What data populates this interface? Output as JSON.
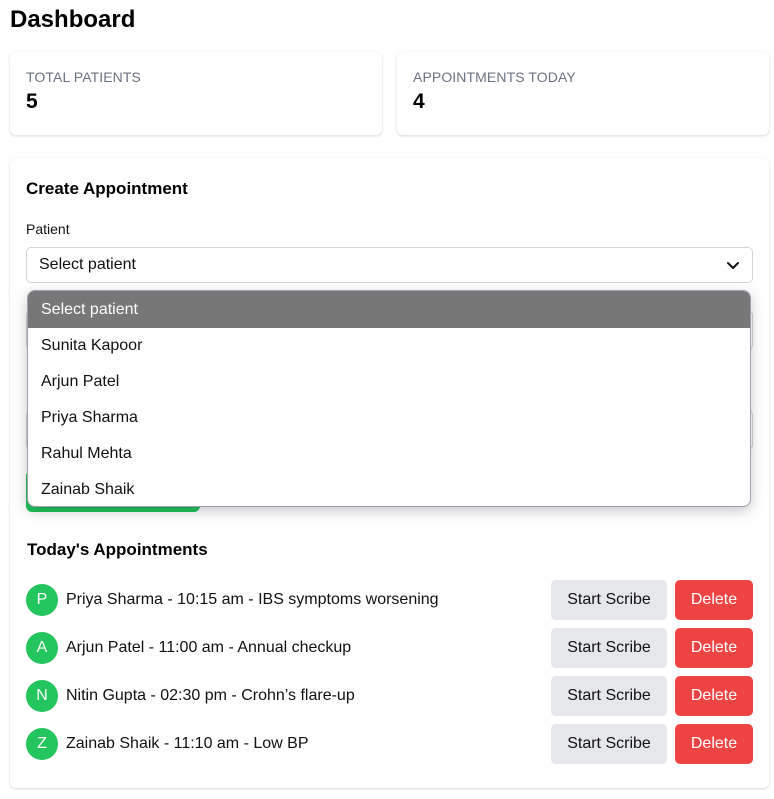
{
  "page": {
    "title": "Dashboard"
  },
  "stats": [
    {
      "label": "TOTAL PATIENTS",
      "value": "5"
    },
    {
      "label": "APPOINTMENTS TODAY",
      "value": "4"
    }
  ],
  "create_appointment": {
    "title": "Create Appointment",
    "patient_label": "Patient",
    "patient_select": {
      "selected": "Select patient",
      "options": [
        "Select patient",
        "Sunita Kapoor",
        "Arjun Patel",
        "Priya Sharma",
        "Rahul Mehta",
        "Zainab Shaik"
      ]
    }
  },
  "todays_appointments": {
    "title": "Today's Appointments",
    "items": [
      {
        "initial": "P",
        "text": "Priya Sharma - 10:15 am - IBS symptoms worsening"
      },
      {
        "initial": "A",
        "text": "Arjun Patel - 11:00 am - Annual checkup"
      },
      {
        "initial": "N",
        "text": "Nitin Gupta - 02:30 pm - Crohn’s flare-up"
      },
      {
        "initial": "Z",
        "text": "Zainab Shaik - 11:10 am - Low BP"
      }
    ],
    "start_scribe_label": "Start Scribe",
    "delete_label": "Delete"
  },
  "colors": {
    "accent_green": "#22c55e",
    "delete_red": "#ef4444",
    "secondary_gray": "#e5e7eb",
    "dropdown_highlight": "#777777"
  }
}
